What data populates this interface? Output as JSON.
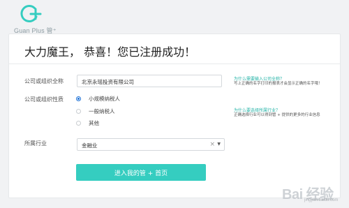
{
  "brand": {
    "logo_text": "Guan Plus 管⁺",
    "accent_color": "#35cdc0"
  },
  "card": {
    "title": "大力魔王， 恭喜！您已注册成功！"
  },
  "form": {
    "company_label": "公司或组织全称",
    "company_value": "北京永瑶投资有限公司",
    "nature_label": "公司或组织性质",
    "nature_options": [
      {
        "label": "小规模纳税人",
        "checked": true
      },
      {
        "label": "一般纳税人",
        "checked": false
      },
      {
        "label": "其他",
        "checked": false
      }
    ],
    "industry_label": "所属行业",
    "industry_value": "金融业",
    "clear_icon": "×",
    "caret_icon": "▼",
    "submit_label": "进入我的管 + 首页"
  },
  "hints": {
    "company_link": "为什么需要输入公司全称？",
    "company_text": "写上正确的名字打印的报表才会显示正确的名字哦！",
    "industry_link": "为什么要选择所属行业？",
    "industry_text": "正确选择行业可以得到管 + 提供的更多的行业信息"
  },
  "watermark": {
    "main": "Bai 经验",
    "sub": "jingyan.baidu.com"
  }
}
